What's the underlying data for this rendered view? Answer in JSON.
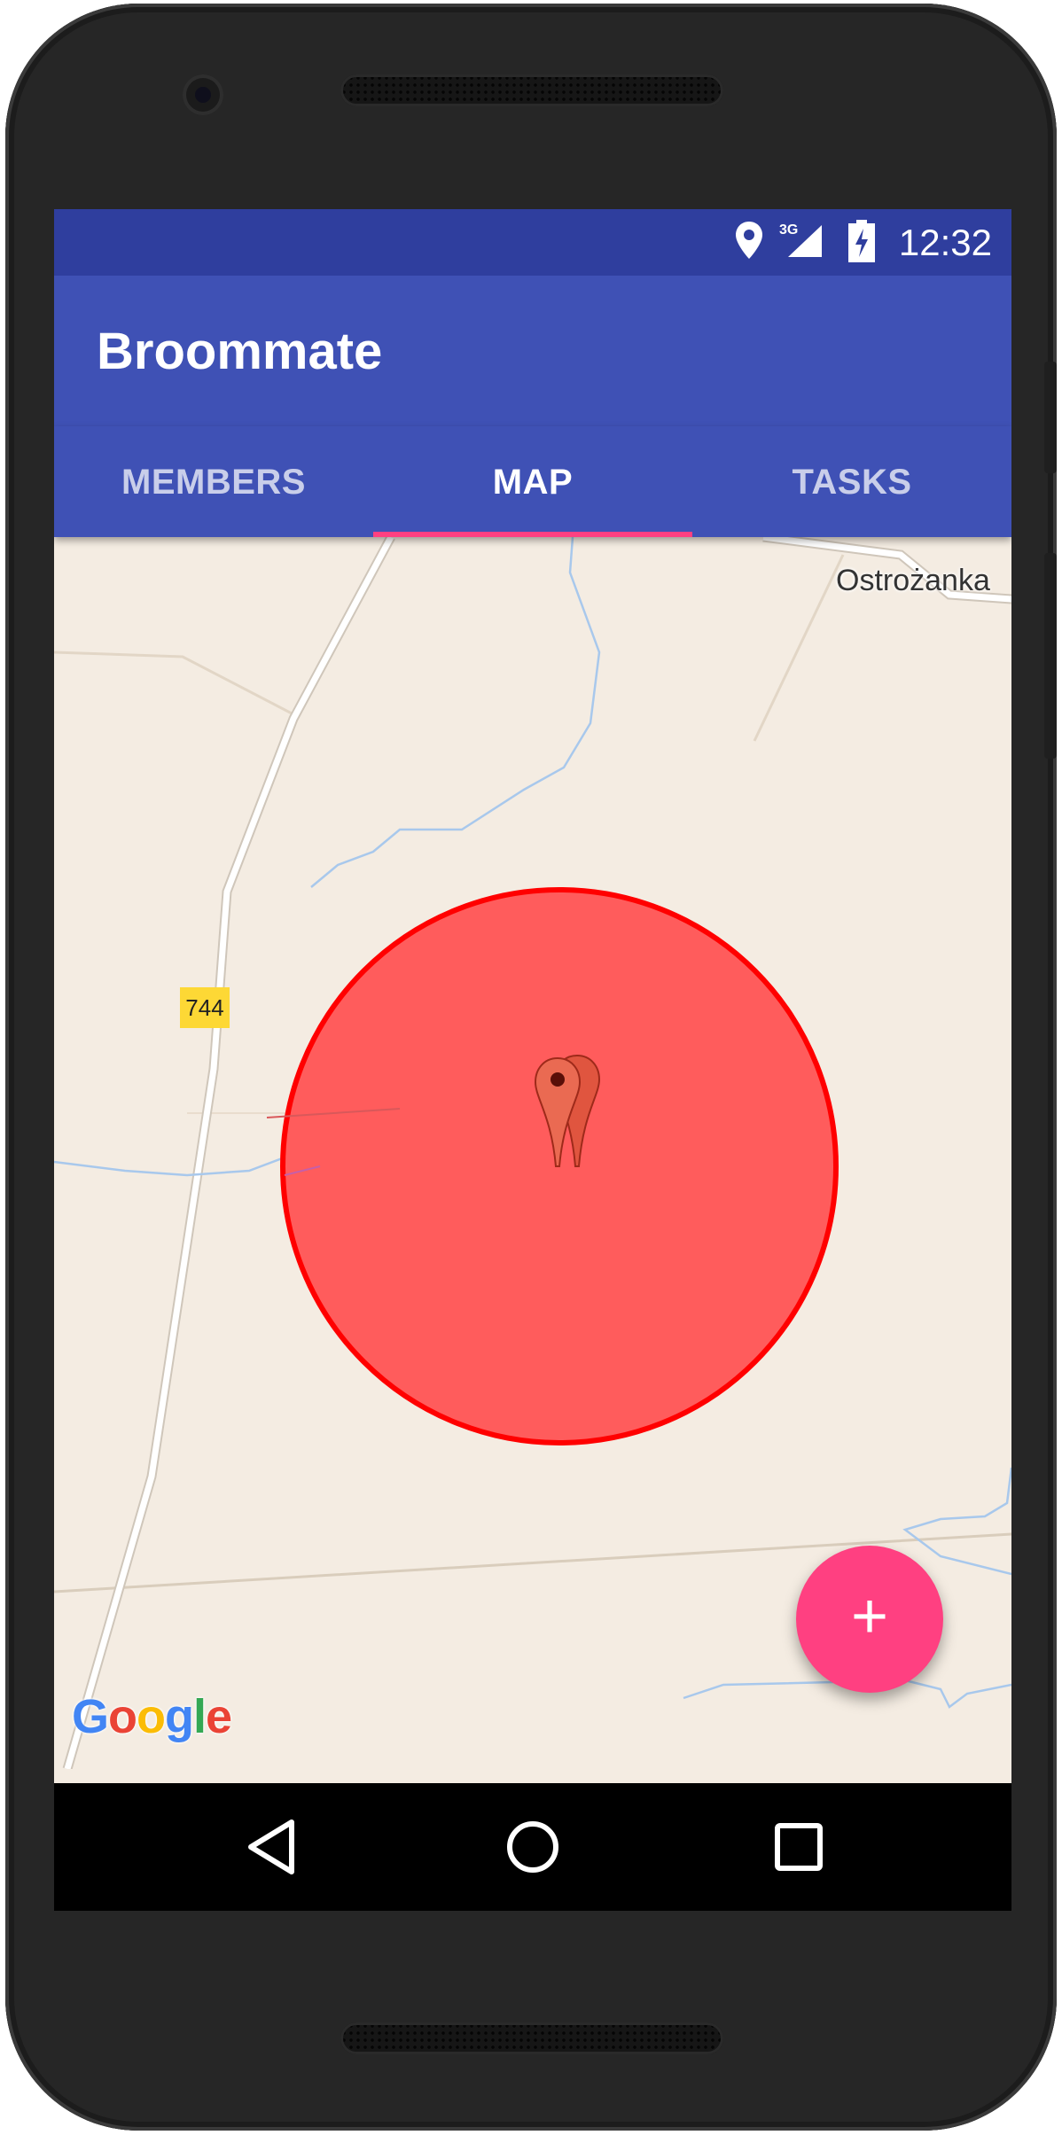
{
  "status_bar": {
    "time": "12:32",
    "network_type": "3G",
    "icons": [
      "location-icon",
      "signal-icon",
      "battery-charging-icon"
    ]
  },
  "app_bar": {
    "title": "Broommate"
  },
  "tabs": [
    {
      "label": "MEMBERS",
      "active": false
    },
    {
      "label": "MAP",
      "active": true
    },
    {
      "label": "TASKS",
      "active": false
    }
  ],
  "map": {
    "place_label": "Ostrożanka",
    "road_number": "744",
    "attribution": "Google",
    "geofence_color": "#ff0000",
    "geofence_fill": "#ff5c5c",
    "markers": [
      "map-pin-icon",
      "map-pin-icon"
    ]
  },
  "fab": {
    "icon": "plus-icon",
    "label": "+"
  },
  "nav_bar": {
    "buttons": [
      "back-icon",
      "home-icon",
      "recents-icon"
    ]
  },
  "colors": {
    "primary": "#3f51b5",
    "primary_dark": "#2f3e9e",
    "accent": "#ff4081"
  }
}
